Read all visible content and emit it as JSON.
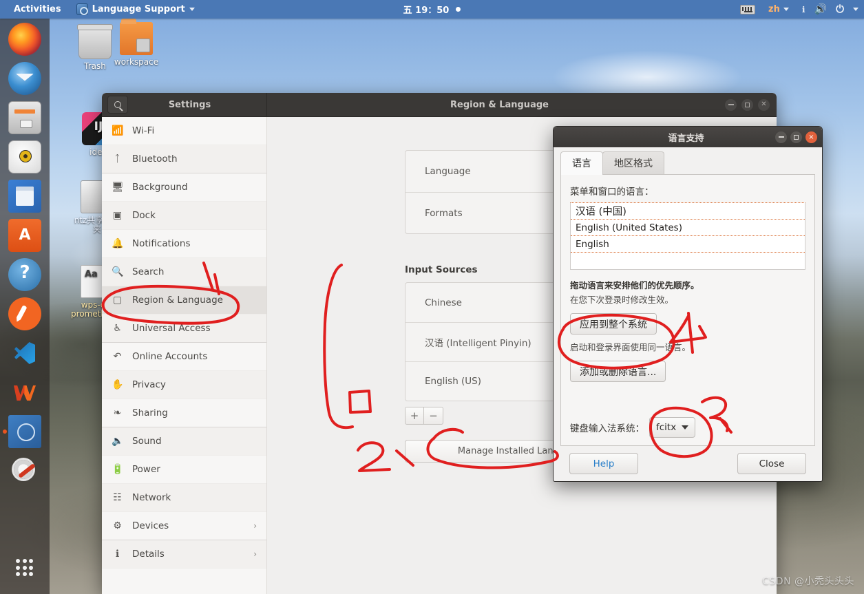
{
  "topbar": {
    "activities": "Activities",
    "app_name": "Language Support",
    "app_icon": "language-support-icon",
    "clock": "五 19：50",
    "indicators": {
      "keyboard_icon": "keyboard-icon",
      "input_method": "zh",
      "help_icon": "help-icon",
      "volume_icon": "volume-icon",
      "power_icon": "power-icon"
    }
  },
  "dock": {
    "items": [
      {
        "name": "firefox",
        "label": "Firefox",
        "running": false
      },
      {
        "name": "thunderbird",
        "label": "Thunderbird Mail",
        "running": false
      },
      {
        "name": "files",
        "label": "Files",
        "running": false
      },
      {
        "name": "rhythmbox",
        "label": "Rhythmbox",
        "running": false
      },
      {
        "name": "libreoffice-writer",
        "label": "LibreOffice Writer",
        "running": false
      },
      {
        "name": "ubuntu-software",
        "label": "Ubuntu Software",
        "running": false
      },
      {
        "name": "help",
        "label": "Help",
        "running": false
      },
      {
        "name": "gimp",
        "label": "GIMP",
        "running": false
      },
      {
        "name": "vscode",
        "label": "Visual Studio Code",
        "running": false
      },
      {
        "name": "wps-office",
        "label": "WPS Office",
        "running": false
      },
      {
        "name": "flag-app",
        "label": "Flag Application",
        "running": true
      },
      {
        "name": "settings-tools",
        "label": "Settings",
        "running": true
      },
      {
        "name": "show-applications",
        "label": "Show Applications",
        "running": false
      }
    ]
  },
  "desktop_icons": [
    {
      "name": "trash",
      "label": "Trash"
    },
    {
      "name": "workspace-folder",
      "label": "workspace"
    },
    {
      "name": "idea-launcher",
      "label": "idea"
    },
    {
      "name": "shared-drive",
      "label": "ntz共享文件夹"
    },
    {
      "name": "wps-desktop-file",
      "label": "wps-cn-prometheus.desktop"
    }
  ],
  "settings_window": {
    "header": {
      "search_icon": "search-icon",
      "sidebar_title": "Settings",
      "main_title": "Region & Language",
      "buttons": {
        "minimize": "minimize",
        "maximize": "maximize",
        "close": "close"
      }
    },
    "sidebar_items": [
      {
        "icon": "wifi-icon",
        "label": "Wi-Fi",
        "selected": false,
        "chevron": false,
        "group_end": false
      },
      {
        "icon": "bluetooth-icon",
        "label": "Bluetooth",
        "selected": false,
        "chevron": false,
        "group_end": true
      },
      {
        "icon": "background-icon",
        "label": "Background",
        "selected": false,
        "chevron": false,
        "group_end": false
      },
      {
        "icon": "dock-icon",
        "label": "Dock",
        "selected": false,
        "chevron": false,
        "group_end": false
      },
      {
        "icon": "notifications-icon",
        "label": "Notifications",
        "selected": false,
        "chevron": false,
        "group_end": false
      },
      {
        "icon": "search-icon",
        "label": "Search",
        "selected": false,
        "chevron": false,
        "group_end": false
      },
      {
        "icon": "region-language-icon",
        "label": "Region & Language",
        "selected": true,
        "chevron": false,
        "group_end": false
      },
      {
        "icon": "universal-access-icon",
        "label": "Universal Access",
        "selected": false,
        "chevron": false,
        "group_end": true
      },
      {
        "icon": "online-accounts-icon",
        "label": "Online Accounts",
        "selected": false,
        "chevron": false,
        "group_end": false
      },
      {
        "icon": "privacy-icon",
        "label": "Privacy",
        "selected": false,
        "chevron": false,
        "group_end": false
      },
      {
        "icon": "sharing-icon",
        "label": "Sharing",
        "selected": false,
        "chevron": false,
        "group_end": true
      },
      {
        "icon": "sound-icon",
        "label": "Sound",
        "selected": false,
        "chevron": false,
        "group_end": false
      },
      {
        "icon": "power-icon",
        "label": "Power",
        "selected": false,
        "chevron": false,
        "group_end": false
      },
      {
        "icon": "network-icon",
        "label": "Network",
        "selected": false,
        "chevron": false,
        "group_end": false
      },
      {
        "icon": "devices-icon",
        "label": "Devices",
        "selected": false,
        "chevron": true,
        "group_end": false
      },
      {
        "icon": "details-icon",
        "label": "Details",
        "selected": false,
        "chevron": true,
        "group_end": false
      }
    ],
    "panel": {
      "language_rows": [
        {
          "label": "Language"
        },
        {
          "label": "Formats"
        }
      ],
      "input_sources_title": "Input Sources",
      "input_sources": [
        {
          "label": "Chinese"
        },
        {
          "label": "汉语 (Intelligent Pinyin)"
        },
        {
          "label": "English (US)"
        }
      ],
      "toolbar": {
        "add": "+",
        "remove": "−",
        "move_up": "⌃",
        "move_down": "⌄"
      },
      "manage_button": "Manage Installed Languages"
    }
  },
  "language_dialog": {
    "title": "语言支持",
    "window_buttons": {
      "minimize": "minimize",
      "maximize": "maximize",
      "close": "×"
    },
    "tabs": [
      {
        "label": "语言",
        "active": true
      },
      {
        "label": "地区格式",
        "active": false
      }
    ],
    "list_label": "菜单和窗口的语言：",
    "languages": [
      "汉语 (中国)",
      "English (United States)",
      "English"
    ],
    "hint_bold": "拖动语言来安排他们的优先顺序。",
    "hint_sub": "在您下次登录时修改生效。",
    "apply_system_button": "应用到整个系统",
    "apply_note": "启动和登录界面使用同一语言。",
    "add_remove_button": "添加或删除语言...",
    "ime_label": "键盘输入法系统：",
    "ime_value": "fcitx",
    "help_button": "Help",
    "close_button": "Close"
  },
  "annotations": {
    "marker_color": "#e01f1f",
    "numbers": [
      "2",
      "3",
      "4"
    ],
    "circled": [
      "region-language-sidebar-item",
      "add-input-source-button",
      "manage-installed-languages-button",
      "apply-to-system-button",
      "ime-combo"
    ]
  },
  "watermark": "CSDN @小秃头头头"
}
